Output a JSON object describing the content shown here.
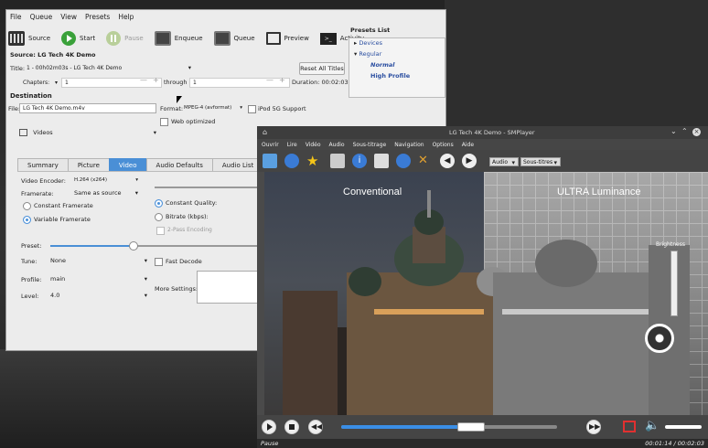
{
  "handbrake": {
    "menu": [
      "File",
      "Queue",
      "View",
      "Presets",
      "Help"
    ],
    "toolbar": {
      "source": "Source",
      "start": "Start",
      "pause": "Pause",
      "enqueue": "Enqueue",
      "queue": "Queue",
      "preview": "Preview",
      "activity": "Activity",
      "terminal_glyph": ">_"
    },
    "source_line": "Source: LG Tech 4K Demo",
    "title_label": "Title:",
    "title_value": "1 - 00h02m03s - LG Tech 4K Demo",
    "reset_all_titles": "Reset All Titles",
    "chapters_label": "Chapters:",
    "chapters_from": "1",
    "through_label": "through",
    "chapters_to": "1",
    "duration": "Duration: 00:02:03",
    "destination": "Destination",
    "file_label": "File:",
    "file_value": "LG Tech 4K Demo.m4v",
    "format_label": "Format:",
    "format_value": "MPEG-4 (avformat)",
    "ipod": "iPod 5G Support",
    "web_optimized": "Web optimized",
    "videos_folder": "Videos",
    "presets": {
      "header": "Presets List",
      "devices": "Devices",
      "regular": "Regular",
      "normal": "Normal",
      "high_profile": "High Profile"
    },
    "tabs": [
      "Summary",
      "Picture",
      "Video",
      "Audio Defaults",
      "Audio List"
    ],
    "active_tab": "Video",
    "video": {
      "encoder_label": "Video Encoder:",
      "encoder_value": "H.264 (x264)",
      "framerate_label": "Framerate:",
      "framerate_value": "Same as source",
      "constant_framerate": "Constant Framerate",
      "variable_framerate": "Variable Framerate",
      "constant_quality": "Constant Quality:",
      "bitrate": "Bitrate (kbps):",
      "two_pass": "2-Pass Encoding",
      "preset_label": "Preset:",
      "tune_label": "Tune:",
      "tune_value": "None",
      "fast_decode": "Fast Decode",
      "profile_label": "Profile:",
      "profile_value": "main",
      "level_label": "Level:",
      "level_value": "4.0",
      "more_settings": "More Settings:"
    }
  },
  "smplayer": {
    "window_title": "LG Tech 4K Demo - SMPlayer",
    "menu": [
      "Ouvrir",
      "Lire",
      "Vidéo",
      "Audio",
      "Sous-titrage",
      "Navigation",
      "Options",
      "Aide"
    ],
    "audio_select": "Audio",
    "subs_select": "Sous-titres",
    "left_label": "Conventional",
    "right_label": "ULTRA Luminance",
    "brightness": "Brightness",
    "status_left": "Pause",
    "status_right": "00:01:14 / 00:02:03",
    "seek_position": 0.6
  }
}
